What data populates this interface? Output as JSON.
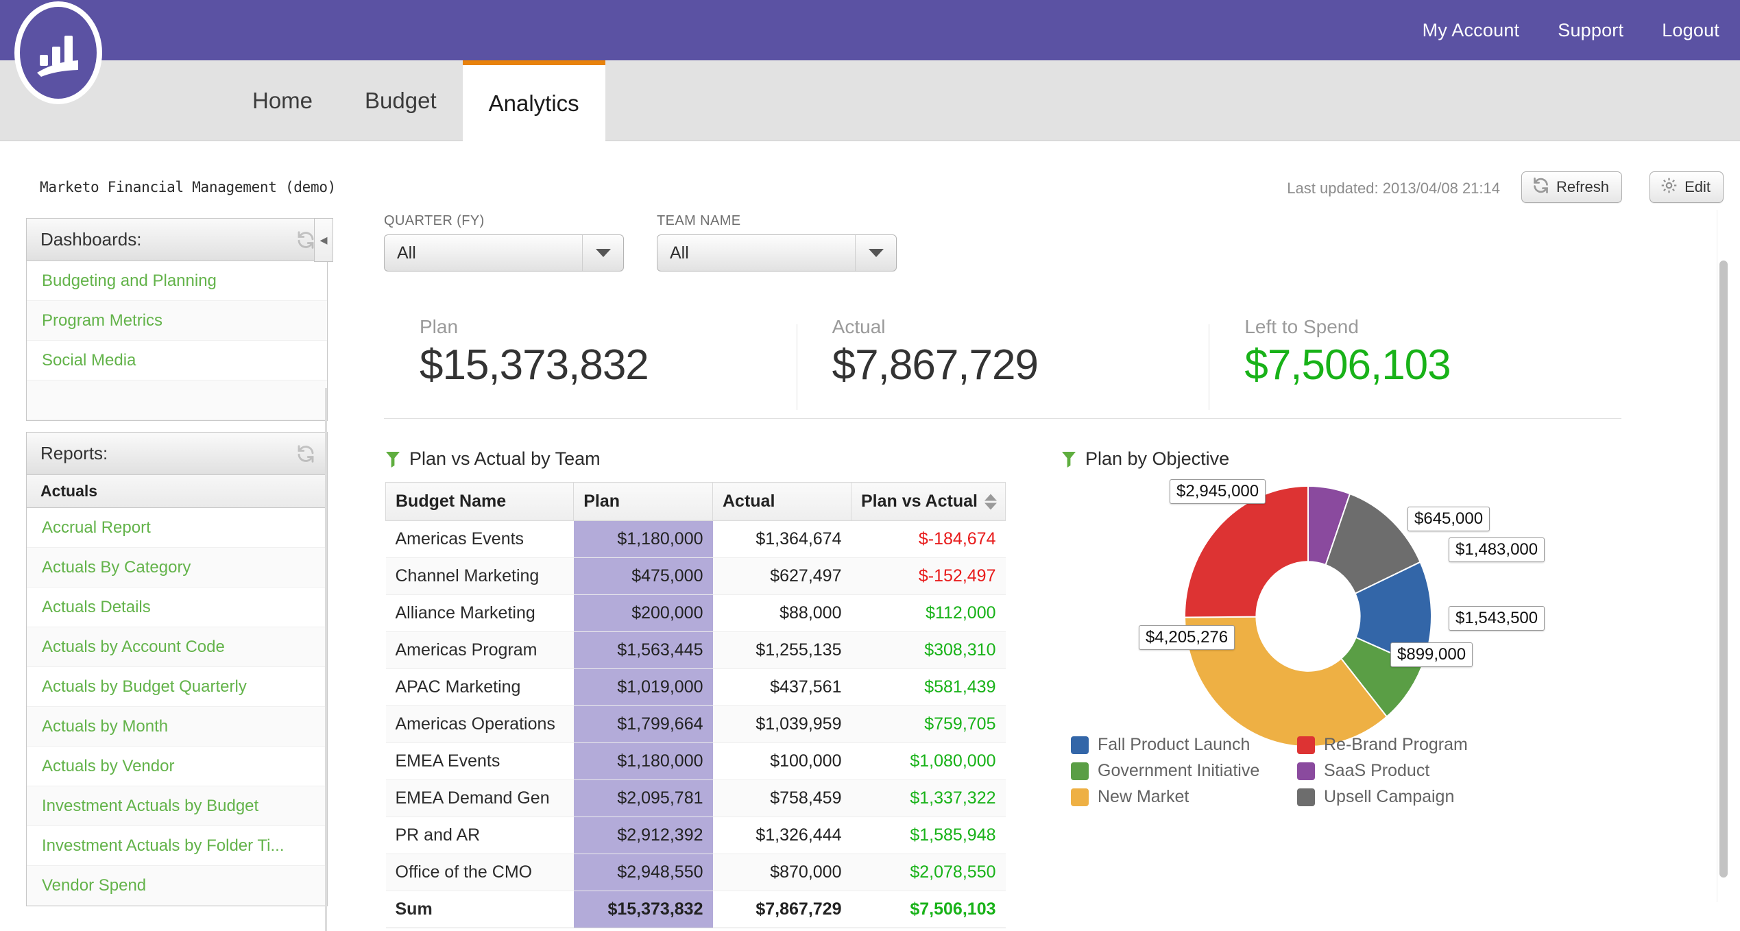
{
  "header": {
    "nav": [
      {
        "label": "My Account"
      },
      {
        "label": "Support"
      },
      {
        "label": "Logout"
      }
    ],
    "logo_name": "marketo-bar-chart-logo",
    "brand_color": "#5b52a3",
    "accent_color": "#e8820c"
  },
  "tabs": [
    {
      "label": "Home",
      "active": false
    },
    {
      "label": "Budget",
      "active": false
    },
    {
      "label": "Analytics",
      "active": true
    }
  ],
  "app_title": "Marketo Financial Management (demo)",
  "toolbar": {
    "last_updated_label": "Last updated:",
    "last_updated_value": "2013/04/08 21:14",
    "last_updated_full": "Last updated:  2013/04/08 21:14",
    "refresh_label": "Refresh",
    "edit_label": "Edit"
  },
  "sidebar": {
    "dashboards": {
      "title": "Dashboards:",
      "items": [
        {
          "label": "Budgeting and Planning"
        },
        {
          "label": "Program Metrics"
        },
        {
          "label": "Social Media"
        },
        {
          "label": ""
        }
      ]
    },
    "reports": {
      "title": "Reports:",
      "group": "Actuals",
      "items": [
        {
          "label": "Accrual Report"
        },
        {
          "label": "Actuals By Category"
        },
        {
          "label": "Actuals Details"
        },
        {
          "label": "Actuals by Account Code"
        },
        {
          "label": "Actuals by Budget Quarterly"
        },
        {
          "label": "Actuals by Month"
        },
        {
          "label": "Actuals by Vendor"
        },
        {
          "label": "Investment Actuals by Budget"
        },
        {
          "label": "Investment Actuals by Folder Ti..."
        },
        {
          "label": "Vendor Spend"
        }
      ]
    },
    "collapse_glyph": "◂"
  },
  "filters": [
    {
      "label": "QUARTER (FY)",
      "value": "All"
    },
    {
      "label": "TEAM NAME",
      "value": "All"
    }
  ],
  "kpis": [
    {
      "label": "Plan",
      "value": "$15,373,832",
      "color": "#333333"
    },
    {
      "label": "Actual",
      "value": "$7,867,729",
      "color": "#333333"
    },
    {
      "label": "Left to Spend",
      "value": "$7,506,103",
      "color": "#18b218"
    }
  ],
  "table": {
    "title": "Plan vs Actual by Team",
    "columns": [
      "Budget Name",
      "Plan",
      "Actual",
      "Plan vs Actual"
    ],
    "rows": [
      {
        "name": "Americas Events",
        "plan": "$1,180,000",
        "actual": "$1,364,674",
        "pva": "$-184,674",
        "pva_sign": "neg"
      },
      {
        "name": "Channel Marketing",
        "plan": "$475,000",
        "actual": "$627,497",
        "pva": "$-152,497",
        "pva_sign": "neg"
      },
      {
        "name": "Alliance Marketing",
        "plan": "$200,000",
        "actual": "$88,000",
        "pva": "$112,000",
        "pva_sign": "pos"
      },
      {
        "name": "Americas Program",
        "plan": "$1,563,445",
        "actual": "$1,255,135",
        "pva": "$308,310",
        "pva_sign": "pos"
      },
      {
        "name": "APAC Marketing",
        "plan": "$1,019,000",
        "actual": "$437,561",
        "pva": "$581,439",
        "pva_sign": "pos"
      },
      {
        "name": "Americas Operations",
        "plan": "$1,799,664",
        "actual": "$1,039,959",
        "pva": "$759,705",
        "pva_sign": "pos"
      },
      {
        "name": "EMEA Events",
        "plan": "$1,180,000",
        "actual": "$100,000",
        "pva": "$1,080,000",
        "pva_sign": "pos"
      },
      {
        "name": "EMEA Demand Gen",
        "plan": "$2,095,781",
        "actual": "$758,459",
        "pva": "$1,337,322",
        "pva_sign": "pos"
      },
      {
        "name": "PR and AR",
        "plan": "$2,912,392",
        "actual": "$1,326,444",
        "pva": "$1,585,948",
        "pva_sign": "pos"
      },
      {
        "name": "Office of the CMO",
        "plan": "$2,948,550",
        "actual": "$870,000",
        "pva": "$2,078,550",
        "pva_sign": "pos"
      }
    ],
    "sum_row": {
      "name": "Sum",
      "plan": "$15,373,832",
      "actual": "$7,867,729",
      "pva": "$7,506,103",
      "pva_sign": "pos"
    },
    "plan_highlight_color": "#b3abd9",
    "positive_color": "#18b218",
    "negative_color": "#e81b1b"
  },
  "chart_data": {
    "type": "pie",
    "title": "Plan by Objective",
    "donut": true,
    "inner_radius_ratio": 0.42,
    "start_angle_deg": 0,
    "direction": "clockwise",
    "total": 11720776,
    "legend_position": "bottom",
    "labels": [
      "SaaS Product",
      "Upsell Campaign",
      "Fall Product Launch",
      "Government Initiative",
      "New Market",
      "Re-Brand Program"
    ],
    "values": [
      645000,
      1483000,
      1543500,
      899000,
      4205276,
      2945000
    ],
    "value_labels": [
      "$645,000",
      "$1,483,000",
      "$1,543,500",
      "$899,000",
      "$4,205,276",
      "$2,945,000"
    ],
    "colors": [
      "#8a4a9e",
      "#6d6d6d",
      "#3366a8",
      "#5a9e45",
      "#eeb044",
      "#dd3333"
    ],
    "legend": [
      {
        "label": "Fall Product Launch",
        "color": "#3366a8",
        "value": 1543500,
        "value_label": "$1,543,500"
      },
      {
        "label": "Government Initiative",
        "color": "#5a9e45",
        "value": 899000,
        "value_label": "$899,000"
      },
      {
        "label": "New Market",
        "color": "#eeb044",
        "value": 4205276,
        "value_label": "$4,205,276"
      },
      {
        "label": "Re-Brand Program",
        "color": "#dd3333",
        "value": 2945000,
        "value_label": "$2,945,000"
      },
      {
        "label": "SaaS Product",
        "color": "#8a4a9e",
        "value": 645000,
        "value_label": "$645,000"
      },
      {
        "label": "Upsell Campaign",
        "color": "#6d6d6d",
        "value": 1483000,
        "value_label": "$1,483,000"
      }
    ]
  }
}
